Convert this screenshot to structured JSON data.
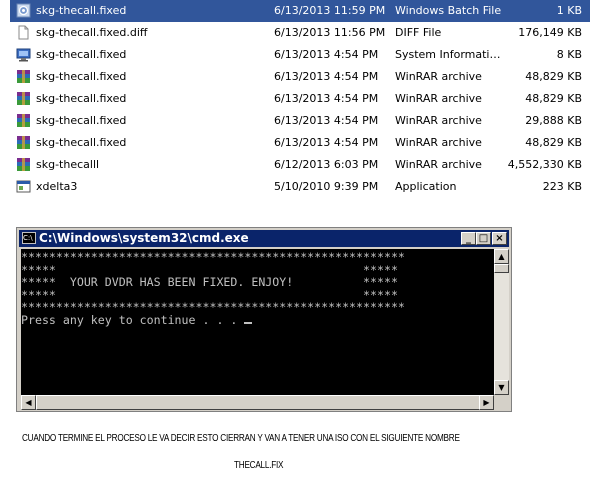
{
  "files": [
    {
      "icon": "batch-file-icon",
      "name": "skg-thecall.fixed",
      "date": "6/13/2013 11:59 PM",
      "type": "Windows Batch File",
      "size": "1 KB",
      "selected": true
    },
    {
      "icon": "blank-file-icon",
      "name": "skg-thecall.fixed.diff",
      "date": "6/13/2013 11:56 PM",
      "type": "DIFF File",
      "size": "176,149 KB"
    },
    {
      "icon": "system-info-icon",
      "name": "skg-thecall.fixed",
      "date": "6/13/2013 4:54 PM",
      "type": "System Information...",
      "size": "8 KB"
    },
    {
      "icon": "winrar-archive-icon",
      "name": "skg-thecall.fixed",
      "date": "6/13/2013 4:54 PM",
      "type": "WinRAR archive",
      "size": "48,829 KB"
    },
    {
      "icon": "winrar-archive-icon",
      "name": "skg-thecall.fixed",
      "date": "6/13/2013 4:54 PM",
      "type": "WinRAR archive",
      "size": "48,829 KB"
    },
    {
      "icon": "winrar-archive-icon",
      "name": "skg-thecall.fixed",
      "date": "6/13/2013 4:54 PM",
      "type": "WinRAR archive",
      "size": "29,888 KB"
    },
    {
      "icon": "winrar-archive-icon",
      "name": "skg-thecall.fixed",
      "date": "6/13/2013 4:54 PM",
      "type": "WinRAR archive",
      "size": "48,829 KB"
    },
    {
      "icon": "winrar-archive-icon",
      "name": "skg-thecalll",
      "date": "6/12/2013 6:03 PM",
      "type": "WinRAR archive",
      "size": "4,552,330 KB"
    },
    {
      "icon": "application-icon",
      "name": "xdelta3",
      "date": "5/10/2010 9:39 PM",
      "type": "Application",
      "size": "223 KB"
    }
  ],
  "cmd": {
    "icon_text": "C:\\",
    "title": "C:\\Windows\\system32\\cmd.exe",
    "minimize": "_",
    "maximize": "□",
    "close": "×",
    "lines": [
      "*******************************************************",
      "*****                                            *****",
      "*****  YOUR DVDR HAS BEEN FIXED. ENJOY!          *****",
      "*****                                            *****",
      "*******************************************************",
      "Press any key to continue . . . "
    ]
  },
  "captions": {
    "line1": "CUANDO TERMINE EL PROCESO LE VA DECIR ESTO CIERRAN Y VAN A TENER UNA ISO CON EL SIGUIENTE NOMBRE",
    "line2": "THECALL.FIX"
  }
}
